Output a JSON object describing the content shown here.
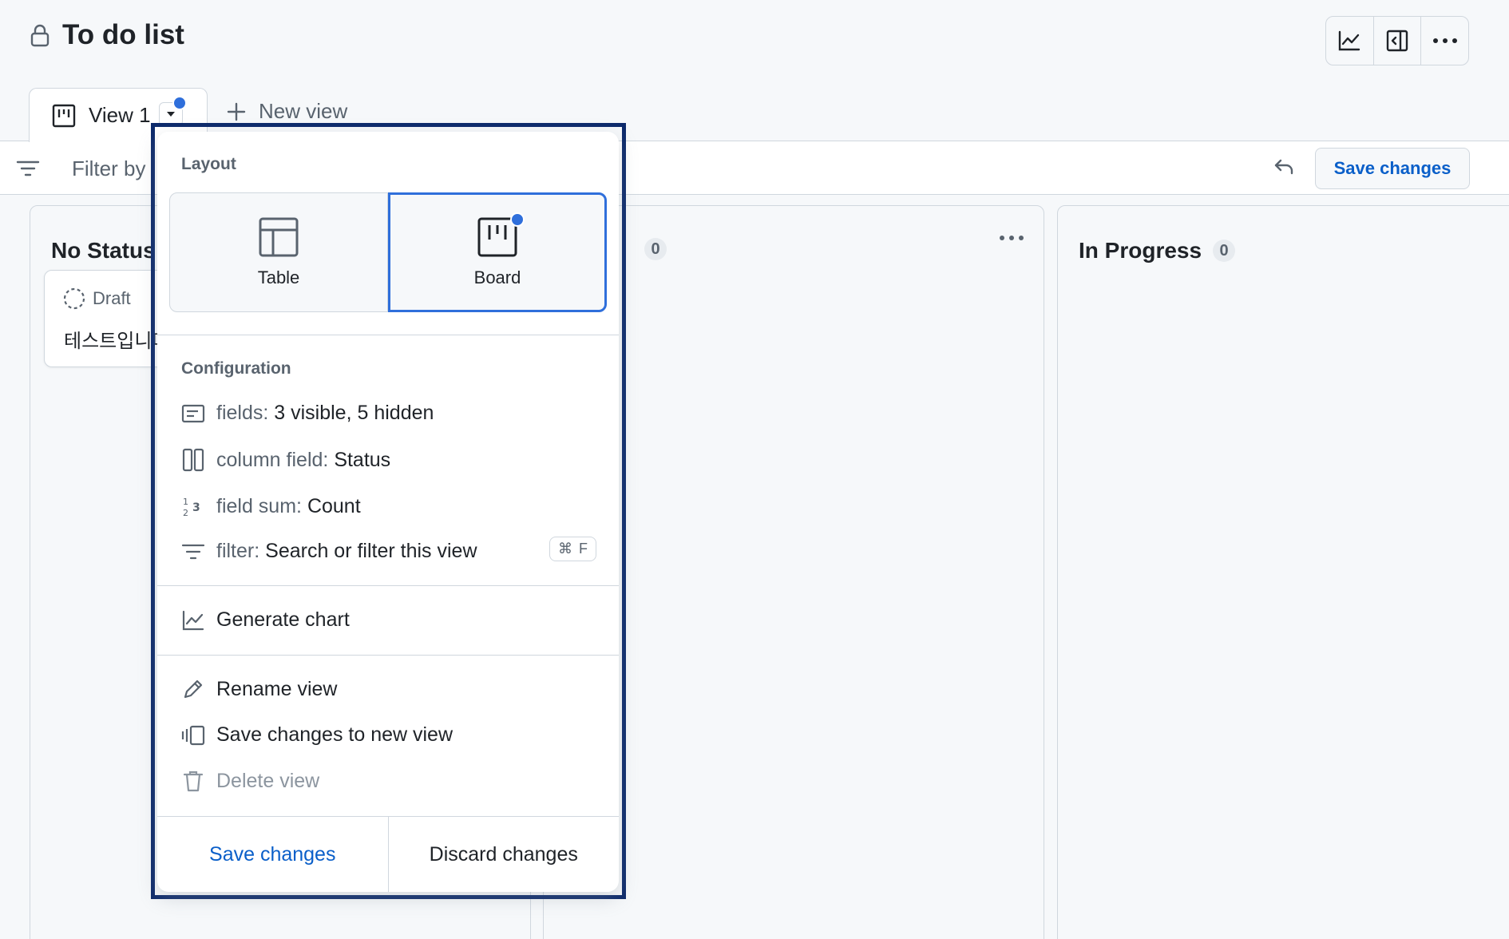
{
  "header": {
    "title": "To do list",
    "actions": [
      "chart-icon",
      "sidebar-panel-icon",
      "kebab-icon"
    ]
  },
  "tabs": {
    "active_label": "View 1",
    "new_view_label": "New view"
  },
  "toolbar": {
    "filter_placeholder": "Filter by",
    "save_label": "Save changes"
  },
  "board": {
    "columns": [
      {
        "title": "No Status"
      },
      {
        "title": "",
        "count": "0"
      },
      {
        "title": "In Progress",
        "count": "0"
      }
    ],
    "card": {
      "status": "Draft",
      "text": "테스트입니다"
    }
  },
  "menu": {
    "layout_label": "Layout",
    "layout_options": [
      {
        "label": "Table",
        "selected": false
      },
      {
        "label": "Board",
        "selected": true
      }
    ],
    "configuration_label": "Configuration",
    "config": [
      {
        "key": "fields:",
        "value": "3 visible, 5 hidden"
      },
      {
        "key": "column field:",
        "value": "Status"
      },
      {
        "key": "field sum:",
        "value": "Count"
      },
      {
        "key": "filter:",
        "value": "Search or filter this view",
        "shortcut_mod": "⌘",
        "shortcut_key": "F"
      }
    ],
    "generate_chart": "Generate chart",
    "rename_view": "Rename view",
    "save_to_new_view": "Save changes to new view",
    "delete_view": "Delete view",
    "footer": {
      "save": "Save changes",
      "discard": "Discard changes"
    }
  },
  "colors": {
    "accent": "#2f6fdb",
    "link": "#0a5fc9",
    "outline": "#0d2a6b",
    "border": "#d0d7de",
    "muted": "#59636e"
  }
}
